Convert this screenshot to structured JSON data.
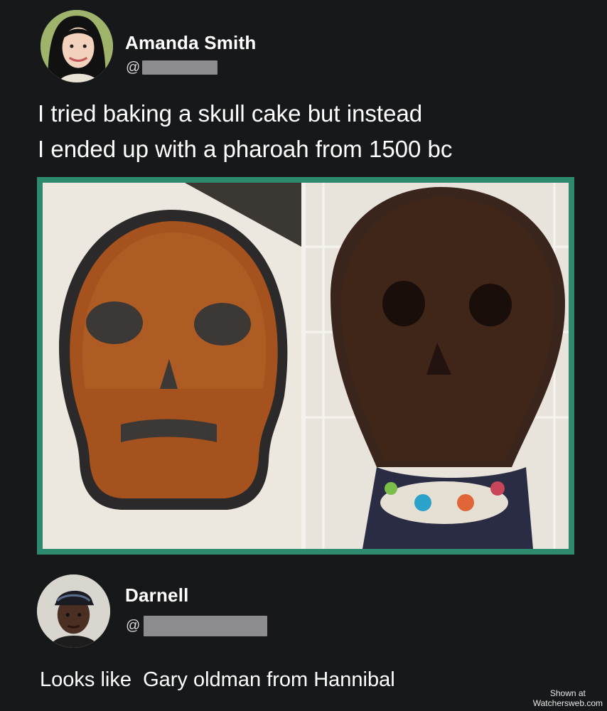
{
  "original_post": {
    "author": {
      "name": "Amanda Smith",
      "handle_prefix": "@"
    },
    "text_line_1": "I tried baking a skull cake but instead",
    "text_line_2": "I ended up with a pharoah from 1500 bc",
    "image_subjects": [
      "skull-pan-batter",
      "baked-skull-cake"
    ]
  },
  "reply": {
    "author": {
      "name": "Darnell",
      "handle_prefix": "@"
    },
    "text": "Looks like  Gary oldman from Hannibal"
  },
  "watermark": {
    "line_1": "Shown at",
    "line_2": "Watchersweb.com"
  },
  "colors": {
    "background": "#17181a",
    "image_border": "#2e8a6e",
    "redaction": "#8c8c8e",
    "text": "#ffffff"
  }
}
